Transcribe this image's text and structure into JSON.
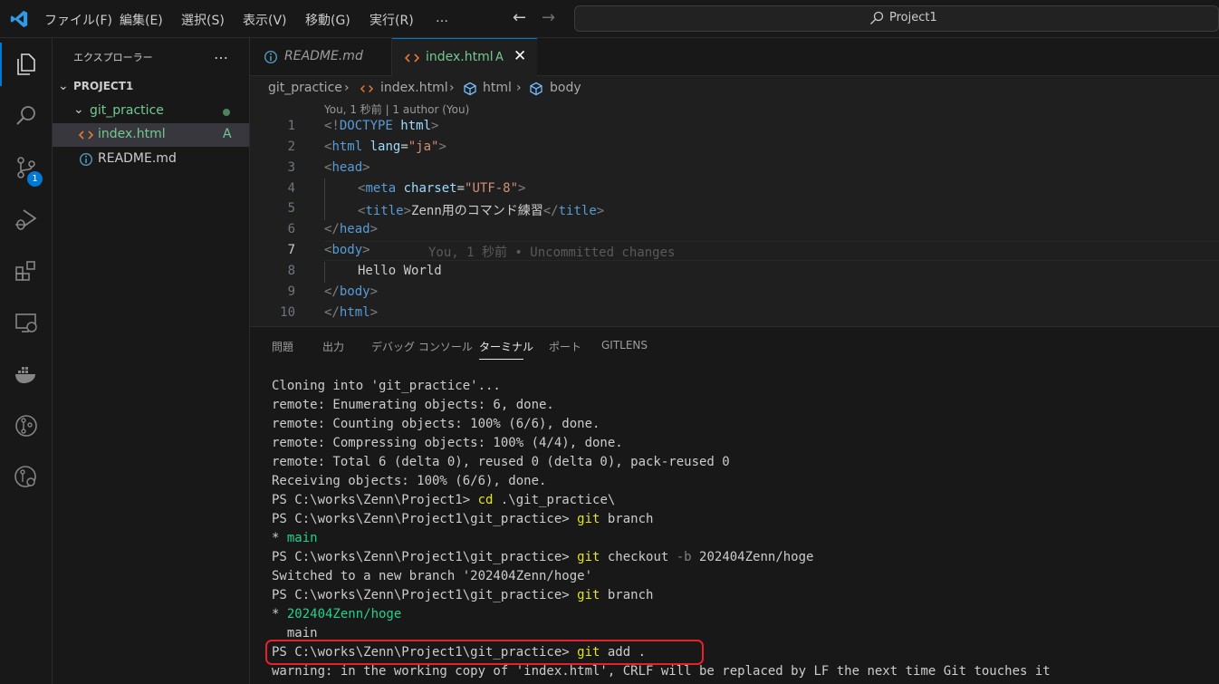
{
  "titlebar": {
    "menus": [
      "ファイル(F)",
      "編集(E)",
      "選択(S)",
      "表示(V)",
      "移動(G)",
      "実行(R)",
      "…"
    ],
    "search_label": "Project1"
  },
  "activity": {
    "scm_badge": "1"
  },
  "sidebar": {
    "title": "エクスプローラー",
    "more": "…",
    "project": "PROJECT1",
    "folder": "git_practice",
    "files": [
      {
        "name": "index.html",
        "status": "A"
      },
      {
        "name": "README.md"
      }
    ]
  },
  "tabs": [
    {
      "label": "README.md"
    },
    {
      "label": "index.html",
      "status": "A"
    }
  ],
  "breadcrumb": [
    "git_practice",
    "index.html",
    "html",
    "body"
  ],
  "editor": {
    "codelens": "You, 1 秒前 | 1 author (You)",
    "line_numbers": [
      "1",
      "2",
      "3",
      "4",
      "5",
      "6",
      "7",
      "8",
      "9",
      "10"
    ],
    "blame": "You, 1 秒前 • Uncommitted changes",
    "lines": {
      "l1": {
        "a": "<!",
        "b": "DOCTYPE",
        "c": " html",
        "d": ">"
      },
      "l2": {
        "a": "<",
        "b": "html",
        "c": " lang",
        "d": "=",
        "e": "\"ja\"",
        "f": ">"
      },
      "l3": {
        "a": "<",
        "b": "head",
        "c": ">"
      },
      "l4": {
        "a": "<",
        "b": "meta",
        "c": " charset",
        "d": "=",
        "e": "\"UTF-8\"",
        "f": ">"
      },
      "l5": {
        "a": "<",
        "b": "title",
        "c": ">",
        "d": "Zenn用のコマンド練習",
        "e": "</",
        "f": "title",
        "g": ">"
      },
      "l6": {
        "a": "</",
        "b": "head",
        "c": ">"
      },
      "l7": {
        "a": "<",
        "b": "body",
        "c": ">"
      },
      "l8": {
        "a": "Hello World"
      },
      "l9": {
        "a": "</",
        "b": "body",
        "c": ">"
      },
      "l10": {
        "a": "</",
        "b": "html",
        "c": ">"
      }
    }
  },
  "panel": {
    "tabs": [
      "問題",
      "出力",
      "デバッグ コンソール",
      "ターミナル",
      "ポート",
      "GITLENS"
    ]
  },
  "terminal": {
    "t1": "Cloning into 'git_practice'...",
    "t2": "remote: Enumerating objects: 6, done.",
    "t3": "remote: Counting objects: 100% (6/6), done.",
    "t4": "remote: Compressing objects: 100% (4/4), done.",
    "t5": "remote: Total 6 (delta 0), reused 0 (delta 0), pack-reused 0",
    "t6": "Receiving objects: 100% (6/6), done.",
    "t7": {
      "prompt": "PS C:\\works\\Zenn\\Project1> ",
      "cmd": "cd",
      "rest": " .\\git_practice\\"
    },
    "t8": {
      "prompt": "PS C:\\works\\Zenn\\Project1\\git_practice> ",
      "cmd": "git",
      "rest": " branch"
    },
    "t9": {
      "star": "* ",
      "branch": "main"
    },
    "t10": {
      "prompt": "PS C:\\works\\Zenn\\Project1\\git_practice> ",
      "cmd": "git",
      "rest": " checkout ",
      "flag": "-b",
      "arg": " 202404Zenn/hoge"
    },
    "t11": "Switched to a new branch '202404Zenn/hoge'",
    "t12": {
      "prompt": "PS C:\\works\\Zenn\\Project1\\git_practice> ",
      "cmd": "git",
      "rest": " branch"
    },
    "t13": {
      "star": "* ",
      "branch": "202404Zenn/hoge"
    },
    "t14": "  main",
    "t15": {
      "prompt": "PS C:\\works\\Zenn\\Project1\\git_practice> ",
      "cmd": "git",
      "rest": " add ."
    },
    "t16": "warning: in the working copy of 'index.html', CRLF will be replaced by LF the next time Git touches it"
  },
  "colors": {
    "accent": "#0078d4",
    "git_added": "#73c991",
    "highlight": "#e8202a",
    "terminal_command": "#e5e510"
  }
}
